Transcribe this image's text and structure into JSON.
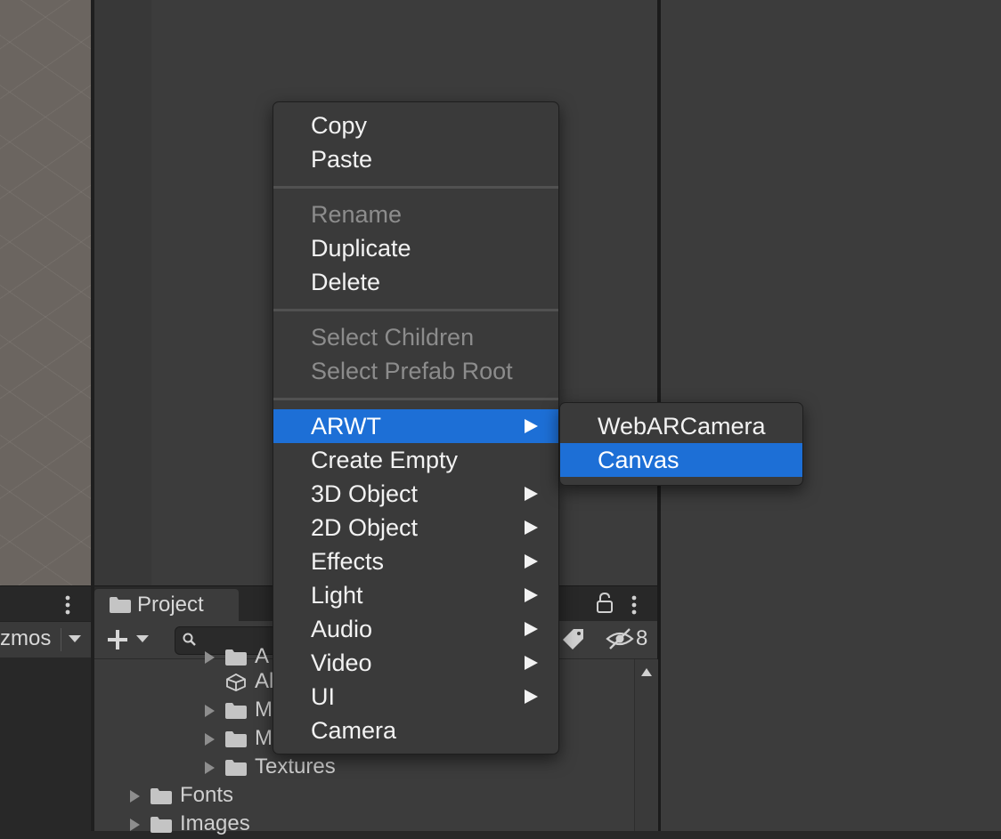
{
  "scene": {
    "gizmos_label": "zmos"
  },
  "project": {
    "tab_label": "Project",
    "hidden_count": "8",
    "tree": [
      {
        "label": "A",
        "icon": "folder-icon",
        "expandable": true
      },
      {
        "label": "Al",
        "icon": "unity-icon",
        "expandable": false
      },
      {
        "label": "M",
        "icon": "folder-icon",
        "expandable": true
      },
      {
        "label": "M",
        "icon": "folder-icon",
        "expandable": true
      },
      {
        "label": "Textures",
        "icon": "folder-icon",
        "expandable": true
      },
      {
        "label": "Fonts",
        "icon": "folder-icon",
        "expandable": true
      },
      {
        "label": "Images",
        "icon": "folder-icon",
        "expandable": true
      }
    ]
  },
  "context_menu": {
    "items": [
      {
        "label": "Copy",
        "enabled": true,
        "submenu": false
      },
      {
        "label": "Paste",
        "enabled": true,
        "submenu": false
      },
      {
        "label": "Rename",
        "enabled": false,
        "submenu": false
      },
      {
        "label": "Duplicate",
        "enabled": true,
        "submenu": false
      },
      {
        "label": "Delete",
        "enabled": true,
        "submenu": false
      },
      {
        "label": "Select Children",
        "enabled": false,
        "submenu": false
      },
      {
        "label": "Select Prefab Root",
        "enabled": false,
        "submenu": false
      },
      {
        "label": "ARWT",
        "enabled": true,
        "submenu": true,
        "highlighted": true
      },
      {
        "label": "Create Empty",
        "enabled": true,
        "submenu": false
      },
      {
        "label": "3D Object",
        "enabled": true,
        "submenu": true
      },
      {
        "label": "2D Object",
        "enabled": true,
        "submenu": true
      },
      {
        "label": "Effects",
        "enabled": true,
        "submenu": true
      },
      {
        "label": "Light",
        "enabled": true,
        "submenu": true
      },
      {
        "label": "Audio",
        "enabled": true,
        "submenu": true
      },
      {
        "label": "Video",
        "enabled": true,
        "submenu": true
      },
      {
        "label": "UI",
        "enabled": true,
        "submenu": true
      },
      {
        "label": "Camera",
        "enabled": true,
        "submenu": false
      }
    ]
  },
  "submenu": {
    "items": [
      {
        "label": "WebARCamera",
        "highlighted": false
      },
      {
        "label": "Canvas",
        "highlighted": true
      }
    ]
  },
  "colors": {
    "highlight": "#1d6fd6",
    "menu_bg": "#3a3a3a",
    "panel_bg": "#3c3c3c",
    "disabled_text": "#8c8c8c"
  }
}
